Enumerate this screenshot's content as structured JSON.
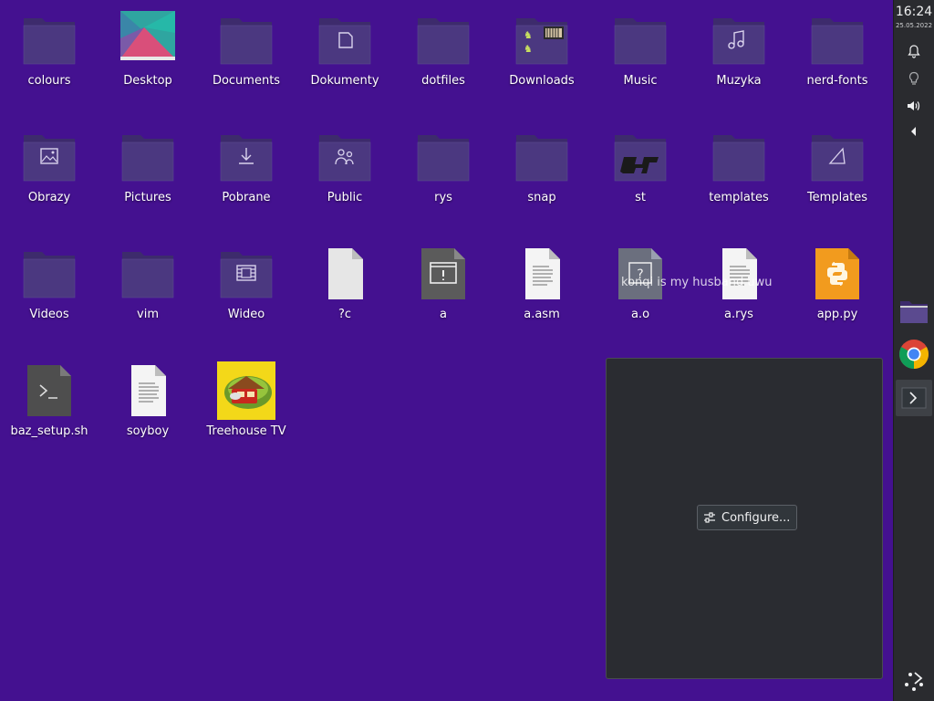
{
  "desktop": {
    "icons": [
      {
        "label": "colours",
        "type": "folder",
        "emblem": ""
      },
      {
        "label": "Desktop",
        "type": "image-thumb",
        "emblem": ""
      },
      {
        "label": "Documents",
        "type": "folder",
        "emblem": ""
      },
      {
        "label": "Dokumenty",
        "type": "folder",
        "emblem": "document"
      },
      {
        "label": "dotfiles",
        "type": "folder",
        "emblem": ""
      },
      {
        "label": "Downloads",
        "type": "folder-preview",
        "emblem": "preview"
      },
      {
        "label": "Music",
        "type": "folder",
        "emblem": ""
      },
      {
        "label": "Muzyka",
        "type": "folder",
        "emblem": "music"
      },
      {
        "label": "nerd-fonts",
        "type": "folder",
        "emblem": ""
      },
      {
        "label": "Obrazy",
        "type": "folder",
        "emblem": "pictures"
      },
      {
        "label": "Pictures",
        "type": "folder",
        "emblem": ""
      },
      {
        "label": "Pobrane",
        "type": "folder",
        "emblem": "download"
      },
      {
        "label": "Public",
        "type": "folder",
        "emblem": "public"
      },
      {
        "label": "rys",
        "type": "folder",
        "emblem": ""
      },
      {
        "label": "snap",
        "type": "folder",
        "emblem": ""
      },
      {
        "label": "st",
        "type": "folder-preview",
        "emblem": "st-preview"
      },
      {
        "label": "templates",
        "type": "folder",
        "emblem": ""
      },
      {
        "label": "Templates",
        "type": "folder",
        "emblem": "templates"
      },
      {
        "label": "Videos",
        "type": "folder",
        "emblem": ""
      },
      {
        "label": "vim",
        "type": "folder",
        "emblem": ""
      },
      {
        "label": "Wideo",
        "type": "folder",
        "emblem": "video"
      },
      {
        "label": "?c",
        "type": "file-blank",
        "emblem": ""
      },
      {
        "label": "a",
        "type": "file-exec",
        "emblem": ""
      },
      {
        "label": "a.asm",
        "type": "file-text",
        "emblem": ""
      },
      {
        "label": "a.o",
        "type": "file-unknown",
        "emblem": ""
      },
      {
        "label": "a.rys",
        "type": "file-text",
        "emblem": ""
      },
      {
        "label": "app.py",
        "type": "file-python",
        "emblem": ""
      },
      {
        "label": "baz_setup.sh",
        "type": "file-script",
        "emblem": ""
      },
      {
        "label": "soyboy",
        "type": "file-text",
        "emblem": ""
      },
      {
        "label": "Treehouse TV",
        "type": "image-treehouse",
        "emblem": ""
      }
    ],
    "overlay_text": "konqi is my husband uwu"
  },
  "widget": {
    "configure_label": "Configure..."
  },
  "panel": {
    "time": "16:24",
    "date": "25.05.2022",
    "tray": [
      {
        "name": "notifications-icon"
      },
      {
        "name": "lightbulb-icon"
      },
      {
        "name": "volume-icon"
      },
      {
        "name": "expand-arrow-icon"
      }
    ],
    "tasks": [
      {
        "name": "dolphin-task",
        "icon": "folder-manager-icon"
      },
      {
        "name": "chrome-task",
        "icon": "chrome-icon"
      },
      {
        "name": "terminal-task",
        "icon": "terminal-icon"
      }
    ]
  },
  "colors": {
    "desktop_bg": "#441190",
    "folder_body": "#4b3880",
    "folder_tab": "#3d2b6c",
    "panel_bg": "#2a2b2f",
    "widget_bg": "#2a2c31"
  }
}
